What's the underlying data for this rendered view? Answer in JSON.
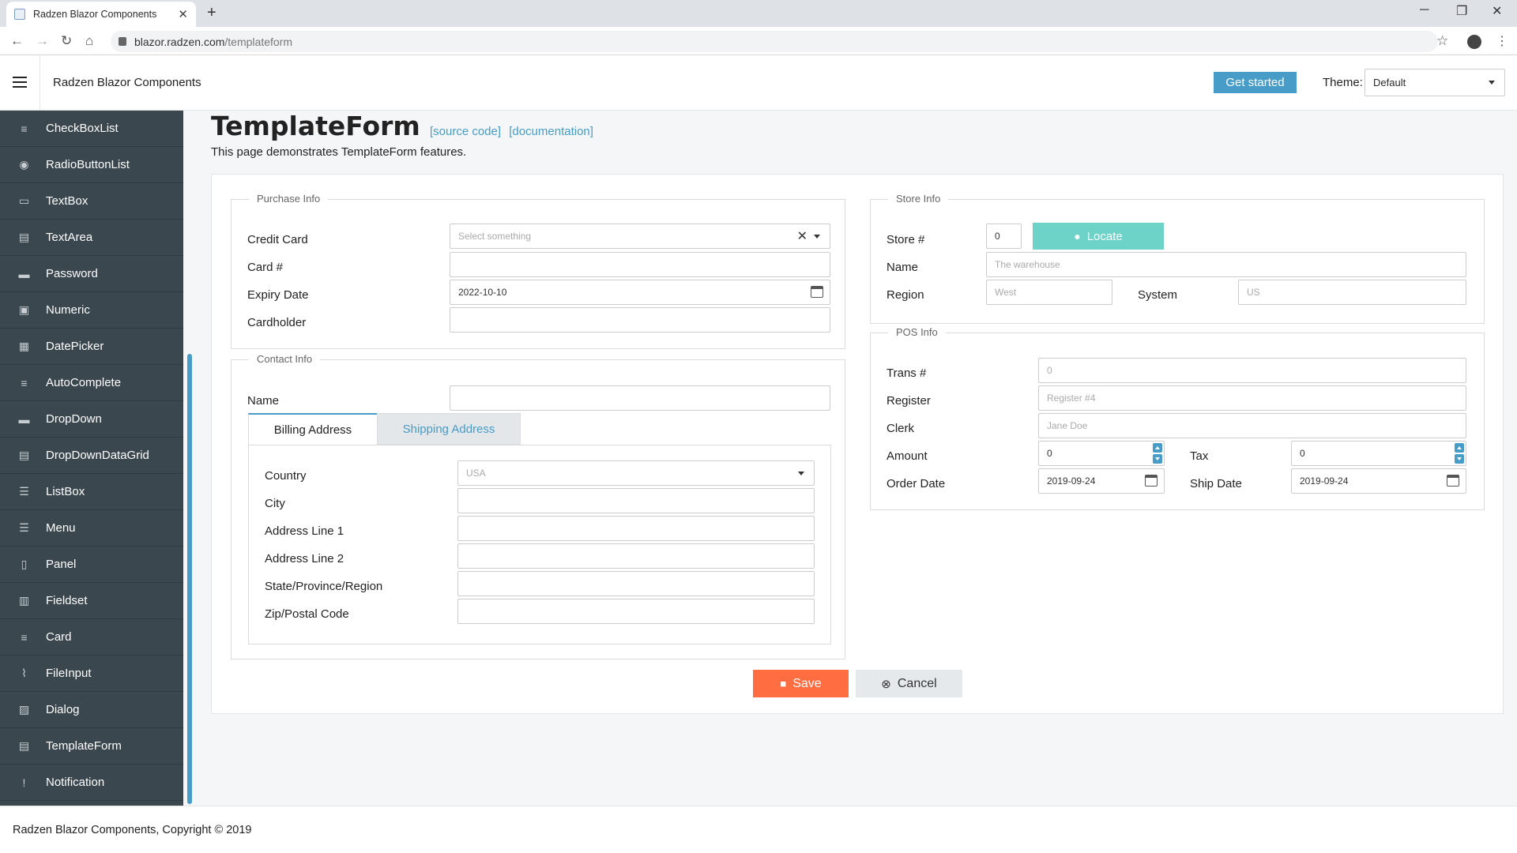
{
  "browser": {
    "tab_title": "Radzen Blazor Components",
    "url_host": "blazor.radzen.com",
    "url_path": "/templateform"
  },
  "header": {
    "app_title": "Radzen Blazor Components",
    "get_started": "Get started",
    "theme_label": "Theme:",
    "theme_value": "Default"
  },
  "sidebar": {
    "items": [
      {
        "label": "CheckBoxList",
        "icon": "checklist-icon"
      },
      {
        "label": "RadioButtonList",
        "icon": "radio-icon"
      },
      {
        "label": "TextBox",
        "icon": "textbox-icon"
      },
      {
        "label": "TextArea",
        "icon": "document-icon"
      },
      {
        "label": "Password",
        "icon": "password-icon"
      },
      {
        "label": "Numeric",
        "icon": "numeric-icon"
      },
      {
        "label": "DatePicker",
        "icon": "calendar-icon"
      },
      {
        "label": "AutoComplete",
        "icon": "playlist-add-icon"
      },
      {
        "label": "DropDown",
        "icon": "dropdown-icon"
      },
      {
        "label": "DropDownDataGrid",
        "icon": "grid-icon"
      },
      {
        "label": "ListBox",
        "icon": "list-icon"
      },
      {
        "label": "Menu",
        "icon": "menu-icon"
      },
      {
        "label": "Panel",
        "icon": "clipboard-icon"
      },
      {
        "label": "Fieldset",
        "icon": "wallet-icon"
      },
      {
        "label": "Card",
        "icon": "card-icon"
      },
      {
        "label": "FileInput",
        "icon": "attachment-icon"
      },
      {
        "label": "Dialog",
        "icon": "image-icon"
      },
      {
        "label": "TemplateForm",
        "icon": "form-icon"
      },
      {
        "label": "Notification",
        "icon": "feedback-icon"
      }
    ]
  },
  "page": {
    "title": "TemplateForm",
    "source_link": "[source code]",
    "doc_link": "[documentation]",
    "description": "This page demonstrates TemplateForm features."
  },
  "purchase": {
    "legend": "Purchase Info",
    "credit_card_label": "Credit Card",
    "credit_card_placeholder": "Select something",
    "card_num_label": "Card #",
    "card_num_value": "",
    "expiry_label": "Expiry Date",
    "expiry_value": "2022-10-10",
    "cardholder_label": "Cardholder",
    "cardholder_value": ""
  },
  "contact": {
    "legend": "Contact Info",
    "name_label": "Name",
    "name_value": "",
    "tabs": [
      "Billing Address",
      "Shipping Address"
    ],
    "country_label": "Country",
    "country_value": "USA",
    "city_label": "City",
    "addr1_label": "Address Line 1",
    "addr2_label": "Address Line 2",
    "state_label": "State/Province/Region",
    "zip_label": "Zip/Postal Code"
  },
  "store": {
    "legend": "Store Info",
    "store_num_label": "Store #",
    "store_num_value": "0",
    "locate_label": "Locate",
    "name_label": "Name",
    "name_placeholder": "The warehouse",
    "region_label": "Region",
    "region_placeholder": "West",
    "system_label": "System",
    "system_placeholder": "US"
  },
  "pos": {
    "legend": "POS Info",
    "trans_label": "Trans #",
    "trans_placeholder": "0",
    "register_label": "Register",
    "register_placeholder": "Register #4",
    "clerk_label": "Clerk",
    "clerk_placeholder": "Jane Doe",
    "amount_label": "Amount",
    "amount_value": "0",
    "tax_label": "Tax",
    "tax_value": "0",
    "order_date_label": "Order Date",
    "order_date_value": "2019-09-24",
    "ship_date_label": "Ship Date",
    "ship_date_value": "2019-09-24"
  },
  "actions": {
    "save": "Save",
    "cancel": "Cancel"
  },
  "footer": {
    "text": "Radzen Blazor Components, Copyright © 2019"
  },
  "colors": {
    "accent": "#479cc8",
    "sidebar_bg": "#3a474e",
    "save_bg": "#ff6d41",
    "locate_bg": "#6dd3c8"
  }
}
